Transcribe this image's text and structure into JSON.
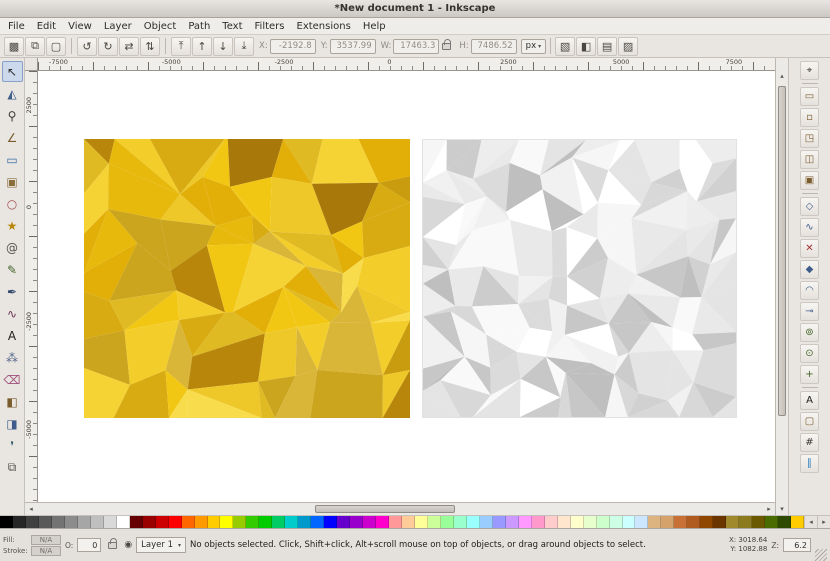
{
  "window": {
    "title": "*New document 1 - Inkscape"
  },
  "menu": {
    "items": [
      "File",
      "Edit",
      "View",
      "Layer",
      "Object",
      "Path",
      "Text",
      "Filters",
      "Extensions",
      "Help"
    ]
  },
  "toolbar": {
    "buttons": [
      {
        "name": "select-all-button",
        "glyph": "▩"
      },
      {
        "name": "select-all-layers-button",
        "glyph": "⧉"
      },
      {
        "name": "deselect-button",
        "glyph": "▢"
      },
      {
        "name": "rotate-ccw-button",
        "glyph": "↺"
      },
      {
        "name": "rotate-cw-button",
        "glyph": "↻"
      },
      {
        "name": "flip-horizontal-button",
        "glyph": "⇄"
      },
      {
        "name": "flip-vertical-button",
        "glyph": "⇅"
      },
      {
        "name": "raise-to-top-button",
        "glyph": "⤒"
      },
      {
        "name": "raise-button",
        "glyph": "↑"
      },
      {
        "name": "lower-button",
        "glyph": "↓"
      },
      {
        "name": "lower-to-bottom-button",
        "glyph": "⤓"
      }
    ],
    "fields": {
      "x_label": "X:",
      "x": "-2192.8",
      "y_label": "Y:",
      "y": "3537.99",
      "w_label": "W:",
      "w": "17463.3",
      "h_label": "H:",
      "h": "7486.52",
      "unit": "px"
    },
    "toggles": [
      {
        "name": "scale-stroke-toggle",
        "glyph": "▧"
      },
      {
        "name": "scale-corners-toggle",
        "glyph": "◧"
      },
      {
        "name": "transform-gradients-toggle",
        "glyph": "▤"
      },
      {
        "name": "transform-patterns-toggle",
        "glyph": "▨"
      }
    ]
  },
  "toolbox": {
    "tools": [
      {
        "name": "selector-tool",
        "glyph": "↖",
        "color": "#2f2d2b",
        "active": true
      },
      {
        "name": "node-tool",
        "glyph": "◭",
        "color": "#3f5d8a"
      },
      {
        "name": "zoom-tool",
        "glyph": "⚲",
        "color": "#3c3a37"
      },
      {
        "name": "measure-tool",
        "glyph": "∠",
        "color": "#7a5c2e"
      },
      {
        "name": "rectangle-tool",
        "glyph": "▭",
        "color": "#3a6ea5"
      },
      {
        "name": "box-3d-tool",
        "glyph": "▣",
        "color": "#8a6d3b"
      },
      {
        "name": "ellipse-tool",
        "glyph": "○",
        "color": "#a05252"
      },
      {
        "name": "star-tool",
        "glyph": "★",
        "color": "#b8860b"
      },
      {
        "name": "spiral-tool",
        "glyph": "@",
        "color": "#555250"
      },
      {
        "name": "pencil-tool",
        "glyph": "✎",
        "color": "#44632a"
      },
      {
        "name": "pen-tool",
        "glyph": "✒",
        "color": "#33466b"
      },
      {
        "name": "calligraphy-tool",
        "glyph": "∿",
        "color": "#6b3355"
      },
      {
        "name": "text-tool",
        "glyph": "A",
        "color": "#1d1c1a"
      },
      {
        "name": "spray-tool",
        "glyph": "⁂",
        "color": "#566a8a"
      },
      {
        "name": "eraser-tool",
        "glyph": "⌫",
        "color": "#a0527a"
      },
      {
        "name": "fill-tool",
        "glyph": "◧",
        "color": "#7a5c2e"
      },
      {
        "name": "gradient-tool",
        "glyph": "◨",
        "color": "#3f5d8a"
      },
      {
        "name": "dropper-tool",
        "glyph": "❜",
        "color": "#35606b"
      },
      {
        "name": "connector-tool",
        "glyph": "⧉",
        "color": "#555250"
      }
    ]
  },
  "rulers": {
    "horizontal": [
      "-7500",
      "-5000",
      "-2500",
      "0",
      "2500",
      "5000",
      "7500"
    ],
    "vertical": [
      "2500",
      "0",
      "-2500",
      "-5000"
    ]
  },
  "canvas": {
    "images": [
      {
        "name": "yellow-crystallize-image",
        "cols": 8,
        "rows": 7,
        "merge": 0.55,
        "palette": [
          "#f2c714",
          "#e6b90c",
          "#d8ab12",
          "#c99b0e",
          "#f6d335",
          "#eec829",
          "#dfba23",
          "#b8860b",
          "#f3ce2b",
          "#cba51d",
          "#f8dc4b",
          "#e2af09",
          "#d9b637",
          "#a8790a"
        ]
      },
      {
        "name": "white-lowpoly-image",
        "cols": 10,
        "rows": 9,
        "merge": 0.3,
        "palette": [
          "#ffffff",
          "#f6f6f6",
          "#ededed",
          "#e4e4e4",
          "#dbdbdb",
          "#d1d1d1",
          "#c7c7c7",
          "#f1f1f1",
          "#e9e9e9",
          "#bfbfbf",
          "#f9f9f9",
          "#d8d8d8",
          "#cccccc"
        ]
      }
    ]
  },
  "snapbar": {
    "buttons": [
      {
        "name": "snap-enable-button",
        "glyph": "⌖",
        "color": "#3c3a37"
      },
      {
        "name": "snap-bbox-button",
        "glyph": "▭",
        "color": "#7a5c2e"
      },
      {
        "name": "snap-bbox-edges-button",
        "glyph": "▫",
        "color": "#7a5c2e"
      },
      {
        "name": "snap-bbox-corners-button",
        "glyph": "◳",
        "color": "#7a5c2e"
      },
      {
        "name": "snap-bbox-edge-midpoints-button",
        "glyph": "◫",
        "color": "#7a5c2e"
      },
      {
        "name": "snap-bbox-centers-button",
        "glyph": "▣",
        "color": "#7a5c2e"
      },
      {
        "name": "snap-nodes-button",
        "glyph": "◇",
        "color": "#3f5d8a"
      },
      {
        "name": "snap-paths-button",
        "glyph": "∿",
        "color": "#3f5d8a"
      },
      {
        "name": "snap-path-intersections-button",
        "glyph": "✕",
        "color": "#a03333"
      },
      {
        "name": "snap-cusp-nodes-button",
        "glyph": "◆",
        "color": "#3f5d8a"
      },
      {
        "name": "snap-smooth-nodes-button",
        "glyph": "◠",
        "color": "#3f5d8a"
      },
      {
        "name": "snap-line-midpoints-button",
        "glyph": "⊸",
        "color": "#3f5d8a"
      },
      {
        "name": "snap-others-button",
        "glyph": "⊚",
        "color": "#44632a"
      },
      {
        "name": "snap-object-centers-button",
        "glyph": "⊙",
        "color": "#44632a"
      },
      {
        "name": "snap-rotation-centers-button",
        "glyph": "+",
        "color": "#44632a"
      },
      {
        "name": "snap-text-baseline-button",
        "glyph": "A",
        "color": "#1d1c1a"
      },
      {
        "name": "snap-page-border-button",
        "glyph": "▢",
        "color": "#7a5c2e"
      },
      {
        "name": "snap-grid-button",
        "glyph": "#",
        "color": "#3c3a37"
      },
      {
        "name": "snap-guides-button",
        "glyph": "∥",
        "color": "#2e7dbd"
      }
    ]
  },
  "palette": {
    "colors": [
      "#000000",
      "#262626",
      "#404040",
      "#595959",
      "#737373",
      "#8c8c8c",
      "#a6a6a6",
      "#bfbfbf",
      "#d9d9d9",
      "#ffffff",
      "#660000",
      "#990000",
      "#cc0000",
      "#ff0000",
      "#ff6600",
      "#ff9900",
      "#ffcc00",
      "#ffff00",
      "#99cc00",
      "#33cc00",
      "#00cc00",
      "#00cc66",
      "#00cccc",
      "#0099cc",
      "#0066ff",
      "#0000ff",
      "#6600cc",
      "#9900cc",
      "#cc00cc",
      "#ff00cc",
      "#ff9999",
      "#ffcc99",
      "#ffff99",
      "#ccff99",
      "#99ff99",
      "#99ffcc",
      "#99ffff",
      "#99ccff",
      "#9999ff",
      "#cc99ff",
      "#ff99ff",
      "#ff99cc",
      "#ffcccc",
      "#ffe6cc",
      "#ffffcc",
      "#e6ffcc",
      "#ccffcc",
      "#ccffe6",
      "#ccffff",
      "#cce6ff",
      "#ddb380",
      "#d4a26a",
      "#c87137",
      "#b05c20",
      "#8f4700",
      "#6b3500",
      "#a0892c",
      "#8c7a1e",
      "#6b5900",
      "#4a6b00",
      "#2d4a00",
      "#ffcc00"
    ]
  },
  "statusbar": {
    "fill_label": "Fill:",
    "fill_value": "N/A",
    "stroke_label": "Stroke:",
    "stroke_value": "N/A",
    "opacity_label": "O:",
    "opacity_value": "0",
    "layer_name": "Layer 1",
    "message": "No objects selected. Click, Shift+click, Alt+scroll mouse on top of objects, or drag around objects to select.",
    "x_label": "X:",
    "x_value": "3018.64",
    "y_label": "Y:",
    "y_value": "1082.88",
    "zoom_label": "Z:",
    "zoom_value": "6.2"
  },
  "icons": {
    "chevron_down": "▾",
    "scroll_up": "▴",
    "scroll_down": "▾",
    "scroll_left": "◂",
    "scroll_right": "▸",
    "eye": "◉"
  }
}
